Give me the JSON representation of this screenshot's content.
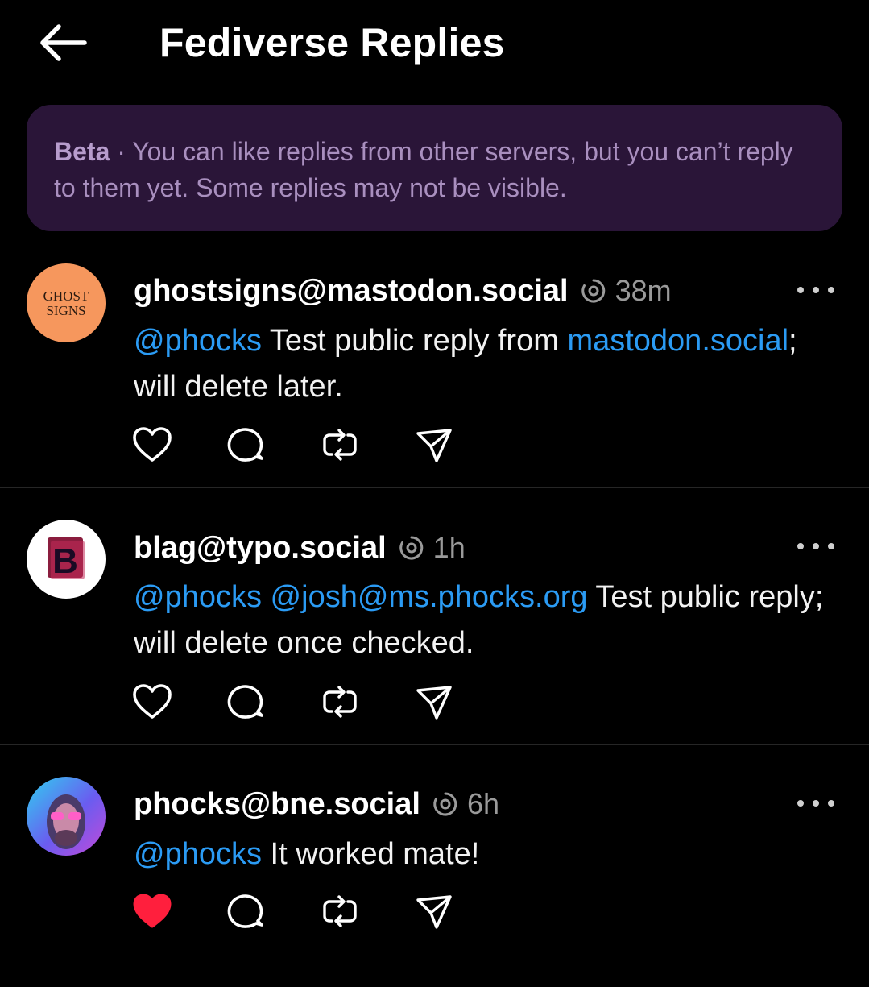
{
  "header": {
    "title": "Fediverse Replies",
    "back_icon": "arrow-left-icon"
  },
  "banner": {
    "label": "Beta",
    "separator": " · ",
    "text": "You can like replies from other servers, but you can’t reply to them yet. Some replies may not be visible."
  },
  "colors": {
    "banner_bg": "#2a1538",
    "mention": "#2b9bf4",
    "liked": "#ff1f3d"
  },
  "replies": [
    {
      "username": "ghostsigns@mastodon.social",
      "time": "38m",
      "avatar_text_1": "GHOST",
      "avatar_text_2": "SIGNS",
      "body": [
        {
          "t": "@phocks",
          "m": true
        },
        {
          "t": " Test public reply from ",
          "m": false
        },
        {
          "t": "mastodon.social",
          "m": true
        },
        {
          "t": "; will delete later.",
          "m": false
        }
      ],
      "liked": false
    },
    {
      "username": "blag@typo.social",
      "time": "1h",
      "avatar_letter": "B",
      "body": [
        {
          "t": "@phocks",
          "m": true
        },
        {
          "t": " ",
          "m": false
        },
        {
          "t": "@josh@ms.phocks.org",
          "m": true
        },
        {
          "t": " Test public reply; will delete once checked.",
          "m": false
        }
      ],
      "liked": false
    },
    {
      "username": "phocks@bne.social",
      "time": "6h",
      "body": [
        {
          "t": "@phocks",
          "m": true
        },
        {
          "t": " It worked mate!",
          "m": false
        }
      ],
      "liked": true
    }
  ]
}
